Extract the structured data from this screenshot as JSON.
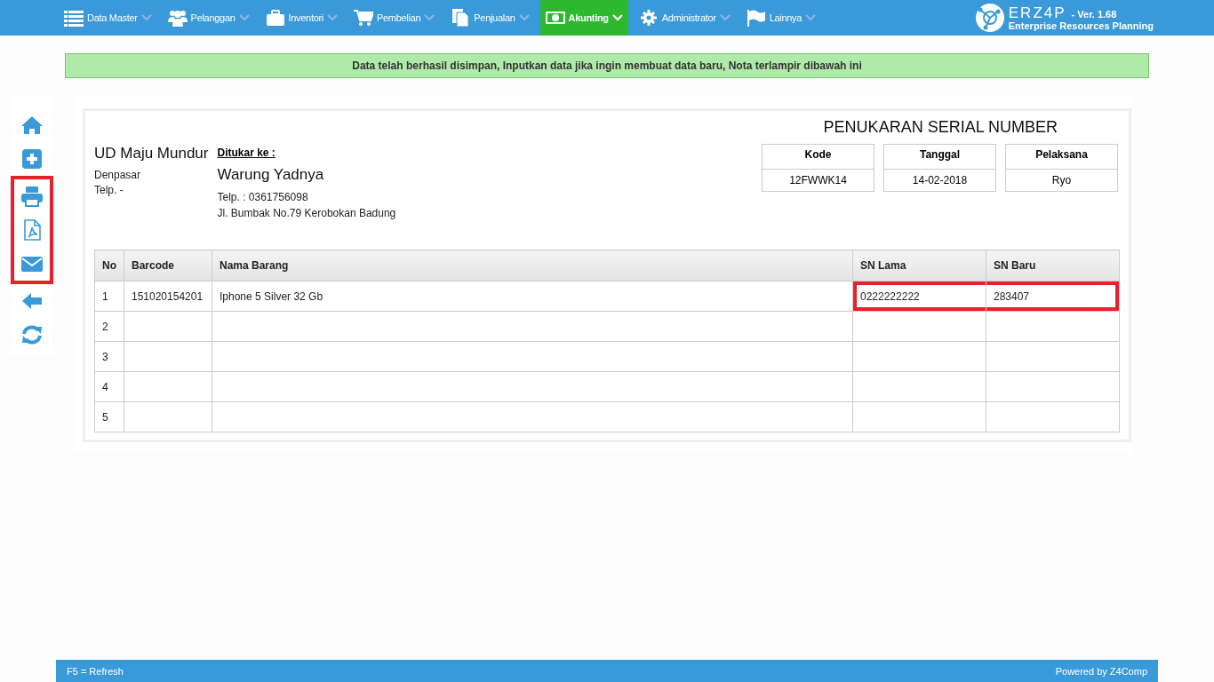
{
  "nav": {
    "items": [
      {
        "label": "Data Master",
        "kind": "list",
        "selected": false
      },
      {
        "label": "Pelanggan",
        "kind": "users",
        "selected": false
      },
      {
        "label": "Inventori",
        "kind": "briefcase",
        "selected": false
      },
      {
        "label": "Pembelian",
        "kind": "cart",
        "selected": false
      },
      {
        "label": "Penjualan",
        "kind": "document",
        "selected": false
      },
      {
        "label": "Akunting",
        "kind": "money",
        "selected": true
      },
      {
        "label": "Administrator",
        "kind": "gear",
        "selected": false
      },
      {
        "label": "Lainnya",
        "kind": "flag",
        "selected": false
      }
    ],
    "brand": {
      "logo": "ERZ4P",
      "version": "- Ver. 1.68",
      "subtitle": "Enterprise Resources Planning"
    }
  },
  "alert": "Data telah berhasil disimpan, Inputkan data jika ingin membuat data baru, Nota terlampir dibawah ini",
  "sidebar": {
    "items": [
      {
        "kind": "home",
        "highlighted": false
      },
      {
        "kind": "add",
        "highlighted": false
      },
      {
        "kind": "print",
        "highlighted": true
      },
      {
        "kind": "pdf",
        "highlighted": true
      },
      {
        "kind": "mail",
        "highlighted": true
      },
      {
        "kind": "back",
        "highlighted": false
      },
      {
        "kind": "refresh",
        "highlighted": false
      }
    ]
  },
  "document": {
    "title": "PENUKARAN SERIAL NUMBER",
    "sender": {
      "name": "UD Maju Mundur",
      "city": "Denpasar",
      "phone": "Telp. -"
    },
    "recipient": {
      "heading": "Ditukar ke :",
      "name": "Warung Yadnya",
      "phone": "Telp. : 0361756098",
      "address": "Jl. Bumbak No.79 Kerobokan Badung"
    },
    "info": [
      {
        "label": "Kode",
        "value": "12FWWK14"
      },
      {
        "label": "Tanggal",
        "value": "14-02-2018"
      },
      {
        "label": "Pelaksana",
        "value": "Ryo"
      }
    ],
    "table": {
      "columns": [
        "No",
        "Barcode",
        "Nama Barang",
        "SN Lama",
        "SN Baru"
      ],
      "rows": [
        {
          "no": "1",
          "barcode": "151020154201",
          "name": "Iphone 5 Silver 32 Gb",
          "sn_lama": "0222222222",
          "sn_baru": "283407",
          "highlighted": true
        },
        {
          "no": "2",
          "highlighted": false
        },
        {
          "no": "3",
          "highlighted": false
        },
        {
          "no": "4",
          "highlighted": false
        },
        {
          "no": "5",
          "highlighted": false
        }
      ]
    }
  },
  "footer": {
    "left": "F5 = Refresh",
    "right": "Powered by Z4Comp"
  }
}
